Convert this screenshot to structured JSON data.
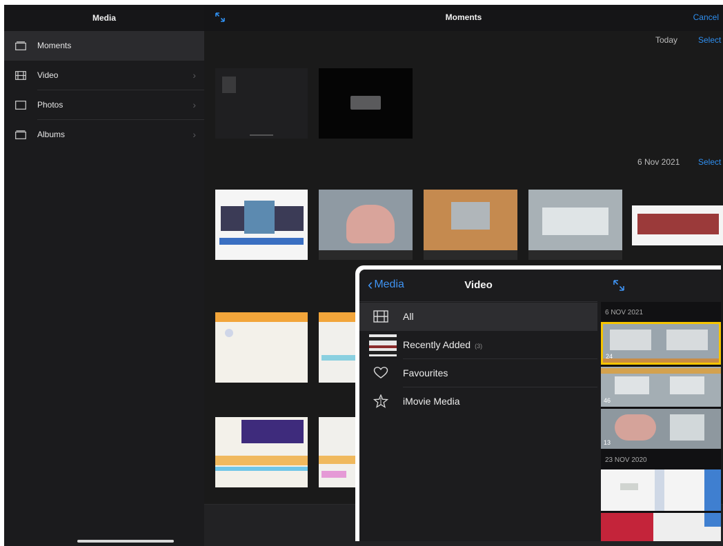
{
  "sidebar": {
    "title": "Media",
    "items": [
      {
        "label": "Moments",
        "icon": "moments-icon",
        "selected": true
      },
      {
        "label": "Video",
        "icon": "film-icon"
      },
      {
        "label": "Photos",
        "icon": "photos-icon"
      },
      {
        "label": "Albums",
        "icon": "albums-icon"
      }
    ]
  },
  "main": {
    "title": "Moments",
    "cancel_label": "Cancel",
    "sections": [
      {
        "date": "Today",
        "select_label": "Select"
      },
      {
        "date": "6 Nov 2021",
        "select_label": "Select"
      }
    ]
  },
  "overlay": {
    "back_label": "Media",
    "title": "Video",
    "items": [
      {
        "label": "All",
        "icon": "film-icon",
        "selected": true
      },
      {
        "label": "Recently Added",
        "count": "(3)",
        "icon": "thumbnail-icon"
      },
      {
        "label": "Favourites",
        "icon": "heart-icon"
      },
      {
        "label": "iMovie Media",
        "icon": "star-icon"
      }
    ],
    "right_dates": [
      "6 NOV 2021",
      "23 NOV 2020"
    ],
    "video_durations": [
      "24",
      "46",
      "13"
    ]
  },
  "colors": {
    "accent": "#2f8ff0",
    "selected_clip_border": "#f5c400",
    "background": "#1c1c1e"
  }
}
